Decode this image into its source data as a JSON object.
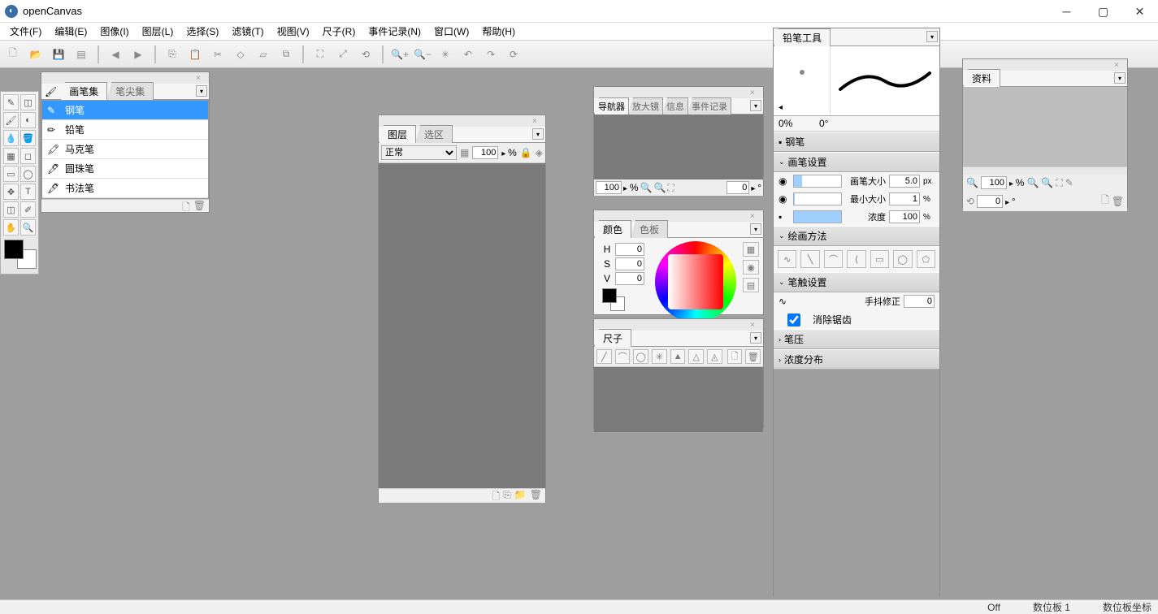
{
  "app": {
    "title": "openCanvas"
  },
  "menu": [
    "文件(F)",
    "编辑(E)",
    "图像(I)",
    "图层(L)",
    "选择(S)",
    "滤镜(T)",
    "视图(V)",
    "尺子(R)",
    "事件记录(N)",
    "窗口(W)",
    "帮助(H)"
  ],
  "brushpanel": {
    "tabs": [
      "画笔集",
      "笔尖集"
    ],
    "items": [
      "钢笔",
      "铅笔",
      "马克笔",
      "圆珠笔",
      "书法笔"
    ],
    "selected": "钢笔"
  },
  "layerpanel": {
    "tabs": [
      "图层",
      "选区"
    ],
    "blend": "正常",
    "opacity": "100",
    "opacity_unit": "%"
  },
  "navpanel": {
    "tabs": [
      "导航器",
      "放大镜",
      "信息",
      "事件记录"
    ],
    "zoom": "100",
    "zoom_unit": "%",
    "rotation": "0",
    "rotation_unit": "°"
  },
  "colorpanel": {
    "tabs": [
      "颜色",
      "色板"
    ],
    "h": "0",
    "s": "0",
    "v": "0"
  },
  "rulerpanel": {
    "tabs": [
      "尺子"
    ]
  },
  "pencilpanel": {
    "tabs": [
      "铅笔工具"
    ],
    "preview_opacity": "0%",
    "preview_angle": "0°",
    "toolname": "钢笔",
    "sections": {
      "brush_settings": "画笔设置",
      "draw_method": "绘画方法",
      "stroke_settings": "笔触设置",
      "pen_pressure": "笔压",
      "opacity_dist": "浓度分布"
    },
    "brush_size_label": "画笔大小",
    "brush_size": "5.0",
    "brush_size_unit": "px",
    "min_size_label": "最小大小",
    "min_size": "1",
    "min_size_unit": "%",
    "opacity_label": "浓度",
    "opacity": "100",
    "opacity_unit": "%",
    "jitter_label": "手抖修正",
    "jitter": "0",
    "antialias_label": "消除锯齿"
  },
  "materialpanel": {
    "tabs": [
      "资料"
    ],
    "zoom": "100",
    "zoom_unit": "%",
    "rotation": "0",
    "rotation_unit": "°"
  },
  "statusbar": {
    "off": "Off",
    "tablet": "数位板 1",
    "tablet_coord": "数位板坐标"
  }
}
